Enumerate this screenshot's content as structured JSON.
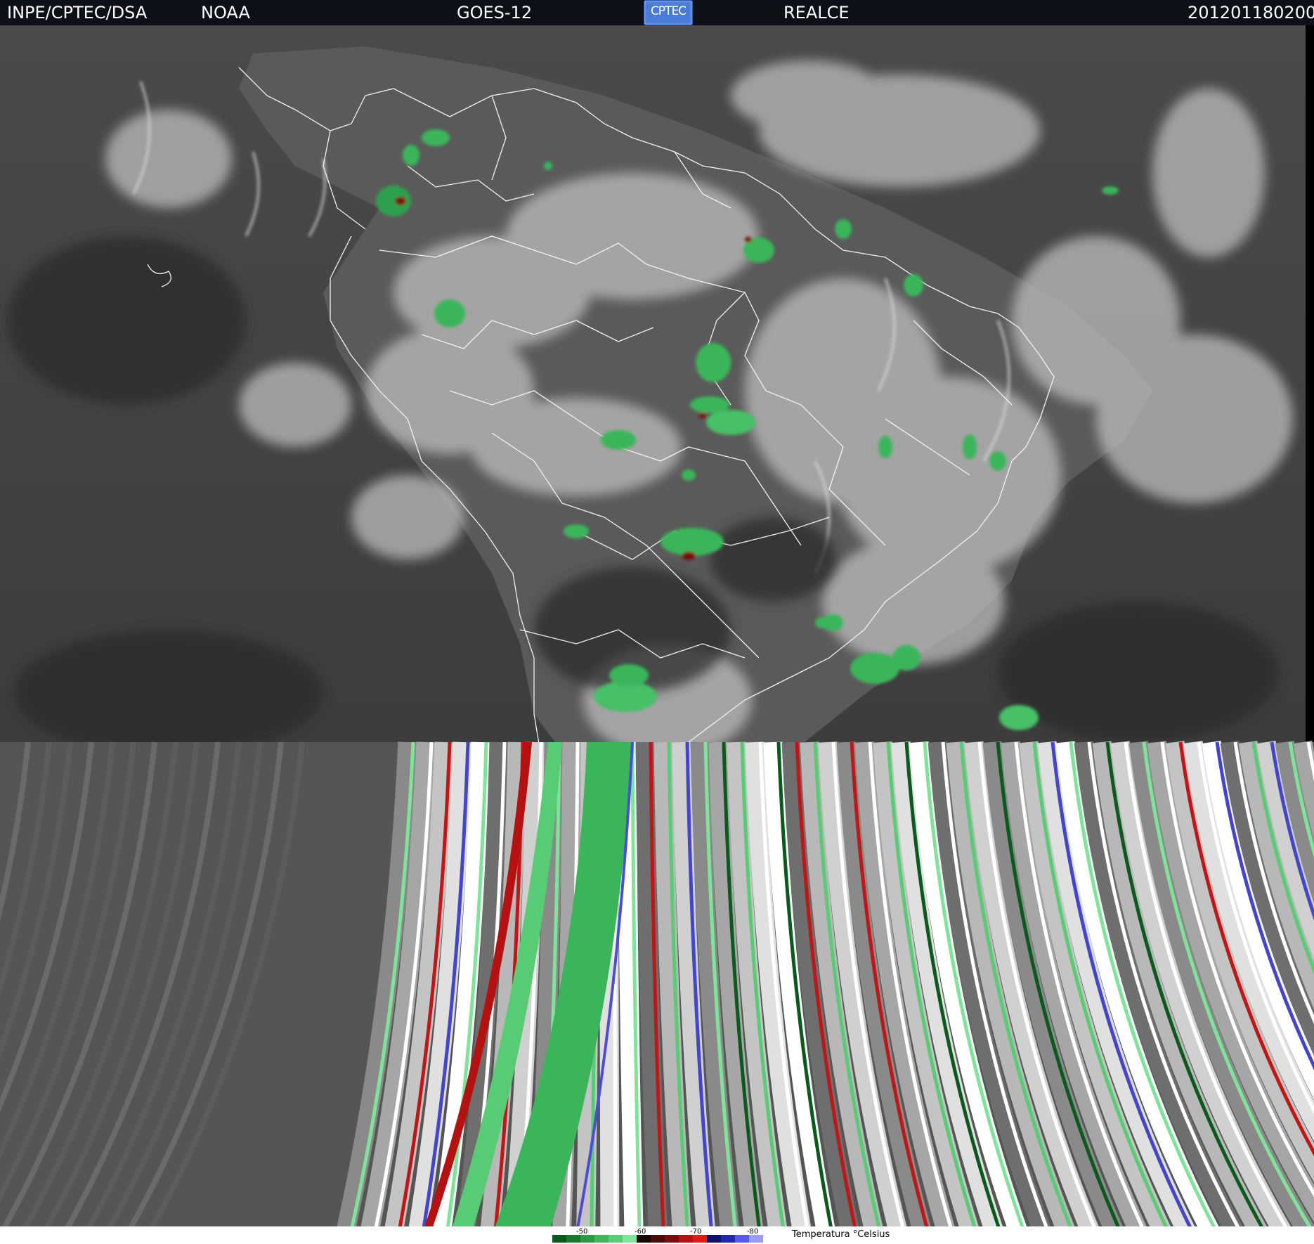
{
  "header": {
    "agency": "INPE/CPTEC/DSA",
    "source": "NOAA",
    "satellite": "GOES-12",
    "logo_text": "CPTEC",
    "product": "REALCE",
    "timestamp": "201201180200"
  },
  "legend": {
    "title": "Temperatura °Celsius",
    "ticks": [
      "-50",
      "-60",
      "-70",
      "-80"
    ],
    "colors": [
      "#0a5a1e",
      "#177a2e",
      "#2a9a44",
      "#3fb55c",
      "#58cc74",
      "#7fe39a",
      "#1a0606",
      "#4a0b0b",
      "#7c0d0d",
      "#b51111",
      "#e11818",
      "#10106a",
      "#2626b0",
      "#5a5ae8",
      "#9a9aff"
    ]
  },
  "map": {
    "projection": "satellite infrared enhanced",
    "overlay": "country and state borders"
  }
}
